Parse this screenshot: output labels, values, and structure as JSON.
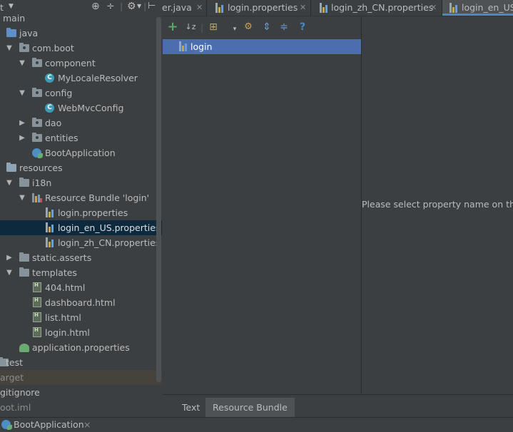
{
  "project": {
    "header_label": "t",
    "rows": [
      {
        "label": "main"
      },
      {
        "label": "java"
      },
      {
        "label": "com.boot"
      },
      {
        "label": "component"
      },
      {
        "label": "MyLocaleResolver",
        "icon_letter": "C"
      },
      {
        "label": "config"
      },
      {
        "label": "WebMvcConfig",
        "icon_letter": "C"
      },
      {
        "label": "dao"
      },
      {
        "label": "entities"
      },
      {
        "label": "BootApplication"
      },
      {
        "label": "resources"
      },
      {
        "label": "i18n"
      },
      {
        "label": "Resource Bundle 'login'"
      },
      {
        "label": "login.properties"
      },
      {
        "label": "login_en_US.properties"
      },
      {
        "label": "login_zh_CN.properties"
      },
      {
        "label": "static.asserts"
      },
      {
        "label": "templates"
      },
      {
        "label": "404.html"
      },
      {
        "label": "dashboard.html"
      },
      {
        "label": "list.html"
      },
      {
        "label": "login.html"
      },
      {
        "label": "application.properties"
      },
      {
        "label": "test"
      },
      {
        "label": "arget"
      },
      {
        "label": "gitignore"
      },
      {
        "label": "oot.iml"
      }
    ]
  },
  "editor_tabs": [
    {
      "label": "er.java"
    },
    {
      "label": "login.properties"
    },
    {
      "label": "login_zh_CN.properties"
    },
    {
      "label": "login_en_US.pro"
    }
  ],
  "bundle_editor": {
    "toolbar": {
      "add": "+",
      "sort": "↓z",
      "group": "⊞",
      "filter": "▾",
      "expand": "⇕",
      "collapse": "≑",
      "help": "?"
    },
    "keys": [
      {
        "label": "login"
      }
    ],
    "hint": "Please select property name on the l",
    "tabs": [
      {
        "label": "Text"
      },
      {
        "label": "Resource Bundle"
      }
    ]
  },
  "run_bar": {
    "label": "BootApplication",
    "close": "×"
  },
  "colors": {
    "accent": "#4a88c7",
    "selection": "#4b6eaf",
    "background": "#3c3f41"
  }
}
